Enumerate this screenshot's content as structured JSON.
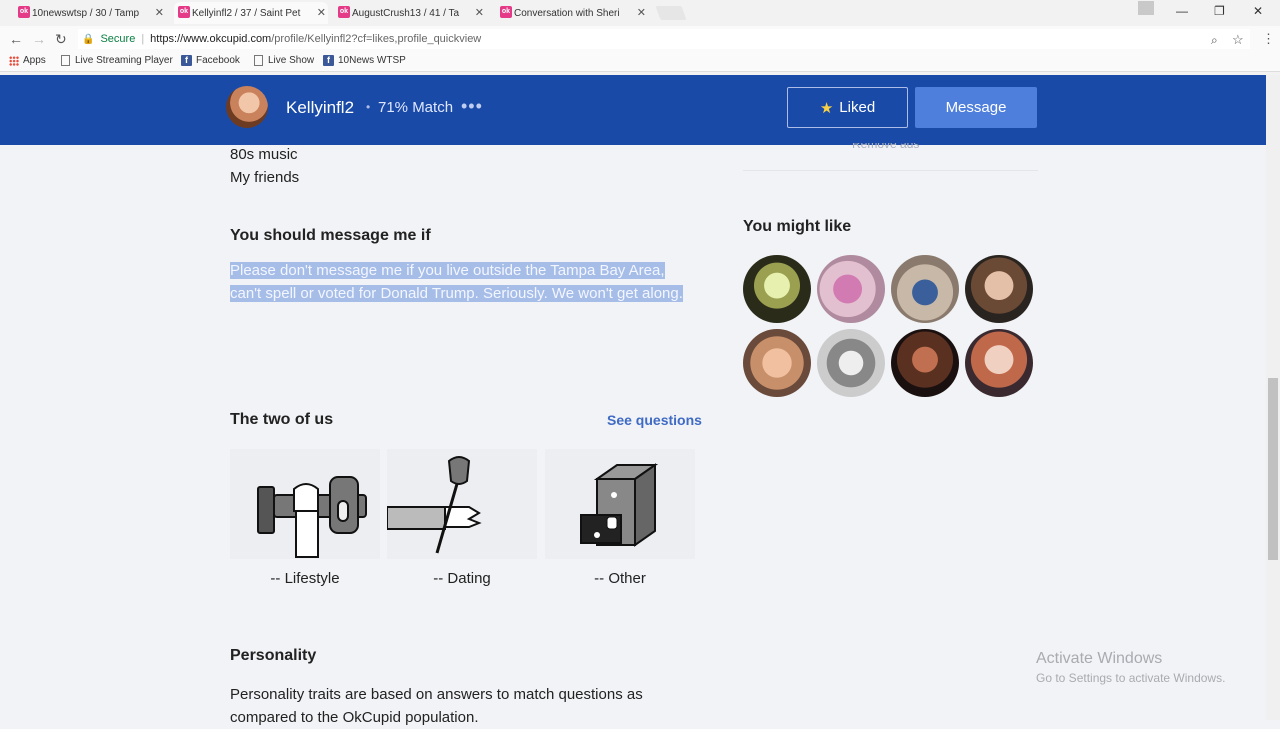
{
  "browser": {
    "tabs": [
      {
        "title": "10newswtsp / 30 / Tamp",
        "favicon": "ok"
      },
      {
        "title": "Kellyinfl2 / 37 / Saint Pet",
        "favicon": "ok"
      },
      {
        "title": "AugustCrush13 / 41 / Ta",
        "favicon": "ok"
      },
      {
        "title": "Conversation with Sheri",
        "favicon": "ok"
      }
    ],
    "secure_label": "Secure",
    "url_host": "https://www.okcupid.com",
    "url_path": "/profile/Kellyinfl2?cf=likes,profile_quickview",
    "bookmarks": [
      "Apps",
      "Live Streaming Player",
      "Facebook",
      "Live Show",
      "10News WTSP"
    ]
  },
  "header": {
    "username": "Kellyinfl2",
    "match": "71% Match",
    "liked_label": "Liked",
    "message_label": "Message"
  },
  "sidebar": {
    "remove_ads": "Remove ads",
    "you_might_like": "You might like"
  },
  "profile": {
    "interests": [
      "80s music",
      "My friends"
    ],
    "message_heading": "You should message me if",
    "message_text": "Please don't message me if you live outside the Tampa Bay Area, can't spell or voted for Donald Trump. Seriously. We won't get along.",
    "two_of_us_heading": "The two of us",
    "see_questions": "See questions",
    "categories": [
      {
        "label": "-- Lifestyle",
        "icon": "weight-lifting-icon"
      },
      {
        "label": "-- Dating",
        "icon": "rose-hand-icon"
      },
      {
        "label": "-- Other",
        "icon": "box-drawer-icon"
      }
    ],
    "personality_heading": "Personality",
    "personality_text": "Personality traits are based on answers to match questions as compared to the OkCupid population."
  },
  "watermark": {
    "line1": "Activate Windows",
    "line2": "Go to Settings to activate Windows."
  },
  "colors": {
    "header_bg": "#1a4aa8",
    "message_button": "#4f7fdc",
    "link": "#3f6bc4",
    "selection": "#a6bde8"
  }
}
